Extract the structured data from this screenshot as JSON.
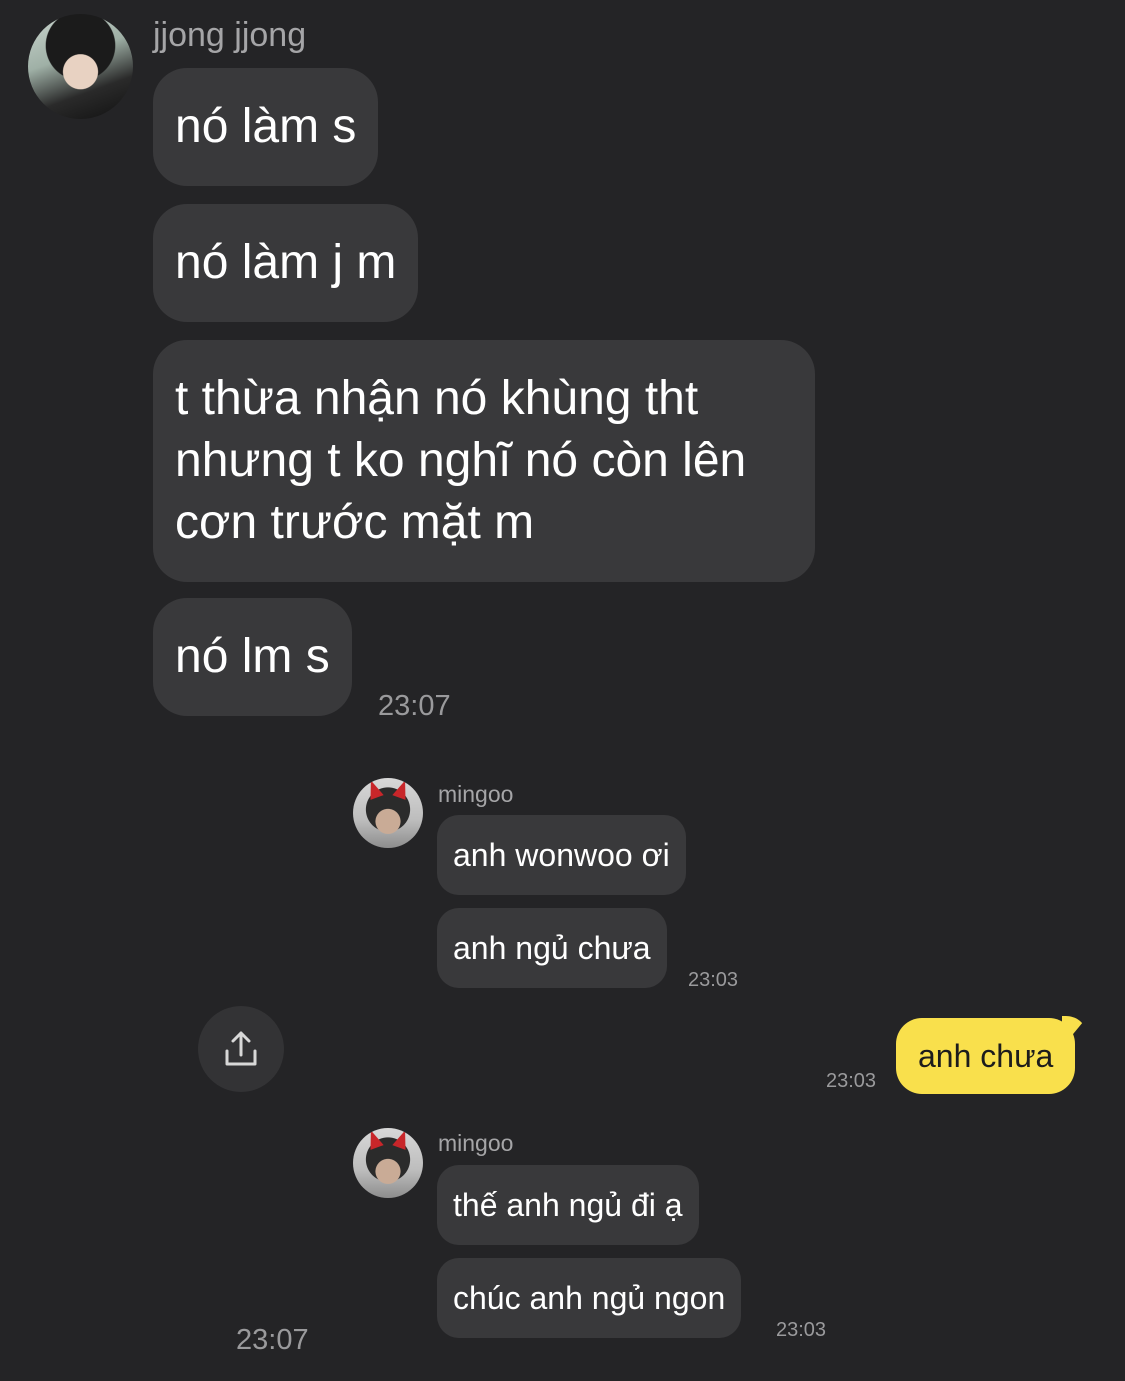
{
  "thread": {
    "sender_jjong": "jjong jjong",
    "sender_mingoo": "mingoo",
    "msg1": "nó làm s",
    "msg2": "nó làm j m",
    "msg3_line1": "t thừa nhận nó khùng tht",
    "msg3_line2": "nhưng t ko nghĩ nó còn lên",
    "msg3_line3": "cơn trước mặt m",
    "msg4": "nó lm s",
    "time_top": "23:07",
    "quoted1_msg1": "anh wonwoo ơi",
    "quoted1_msg2": "anh ngủ chưa",
    "quoted1_time": "23:03",
    "reply_msg": "anh chưa",
    "reply_time": "23:03",
    "quoted2_msg1": "thế anh ngủ đi ạ",
    "quoted2_msg2": "chúc anh ngủ ngon",
    "quoted2_time": "23:03",
    "time_bottom": "23:07"
  },
  "icons": {
    "share": "share-icon",
    "avatar_jjong": "avatar-jjong",
    "avatar_mingoo": "avatar-mingoo"
  },
  "colors": {
    "background": "#242426",
    "bubble": "#39393b",
    "my_bubble": "#f9e04c"
  }
}
